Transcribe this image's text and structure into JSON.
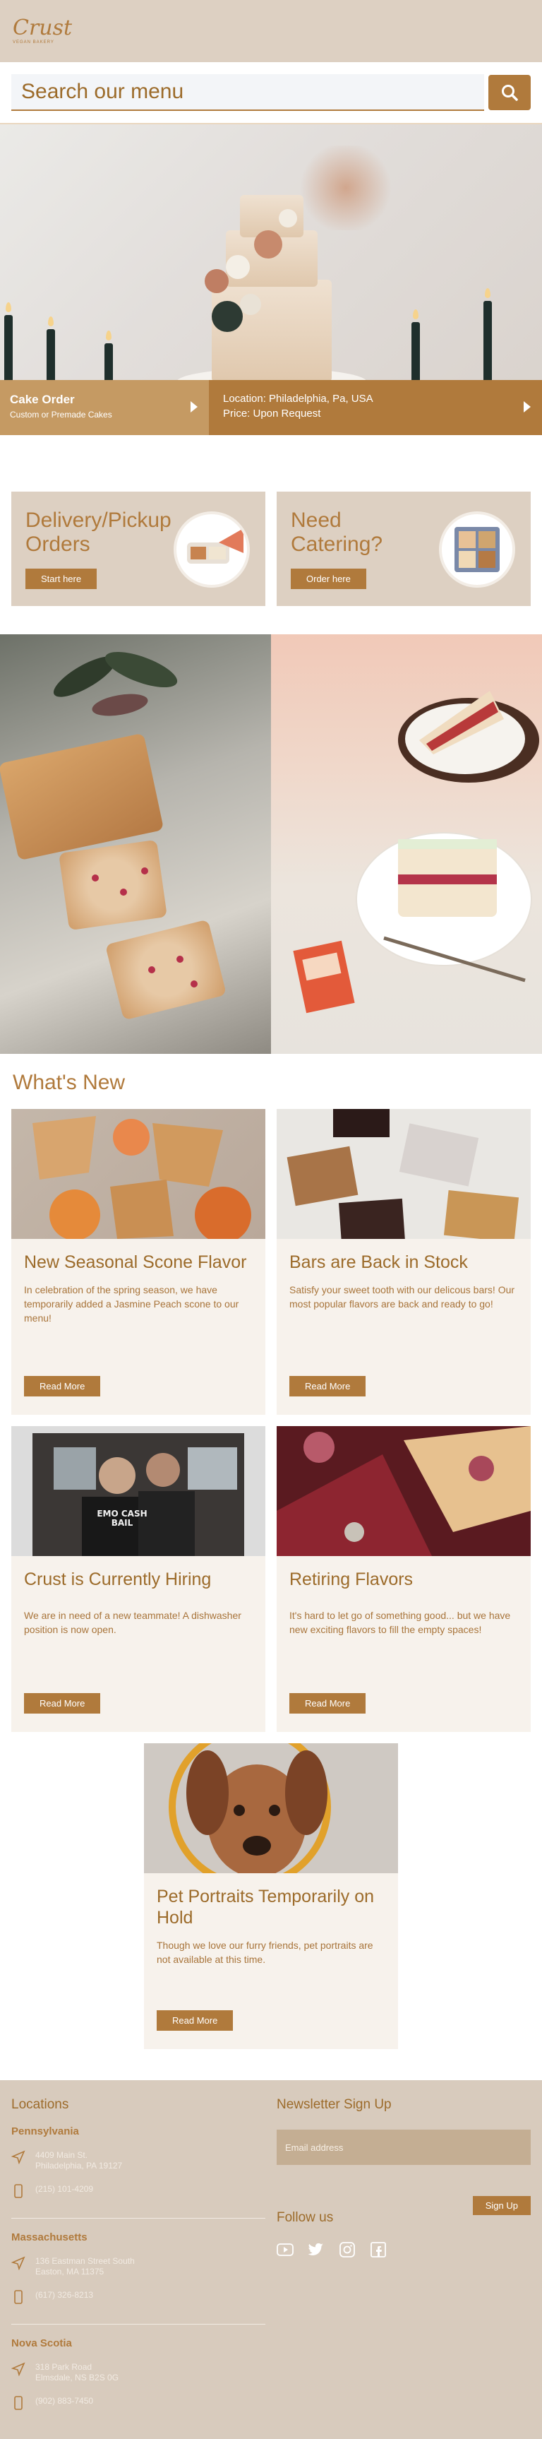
{
  "header": {
    "logo": "Crust",
    "logo_sub": "VEGAN BAKERY",
    "search_placeholder": "Search our menu"
  },
  "hero": {
    "left_title": "Cake Order",
    "left_sub": "Custom or Premade Cakes",
    "right_line1": "Location: Philadelphia, Pa, USA",
    "right_line2": "Price: Upon Request"
  },
  "tiles": [
    {
      "title": "Delivery/Pickup Orders",
      "button": "Start here"
    },
    {
      "title": "Need Catering?",
      "button": "Order here"
    }
  ],
  "whats_new": {
    "title": "What's New",
    "cards": [
      {
        "title": "New Seasonal Scone Flavor",
        "text": "In celebration of the spring season, we have temporarily added a Jasmine Peach scone to our menu!",
        "button": "Read More"
      },
      {
        "title": "Bars are Back in Stock",
        "text": "Satisfy your sweet tooth with our delicous bars! Our most popular flavors are back and ready to go!",
        "button": "Read More"
      },
      {
        "title": "Crust is Currently Hiring",
        "text": "We are in need of a new teammate! A dishwasher position is now open.",
        "button": "Read More"
      },
      {
        "title": "Retiring Flavors",
        "text": "It's hard to let go of something good... but we have new exciting flavors to fill the empty spaces!",
        "button": "Read More"
      },
      {
        "title": "Pet Portraits Temporarily on Hold",
        "text": "Though we love our furry friends, pet portraits are not available at this time.",
        "button": "Read More"
      }
    ],
    "shirt_text": "EMO CASH BAIL"
  },
  "footer": {
    "locations_title": "Locations",
    "locations": [
      {
        "state": "Pennsylvania",
        "address1": "4409 Main St.",
        "address2": "Philadelphia, PA 19127",
        "phone": "(215) 101-4209"
      },
      {
        "state": "Massachusetts",
        "address1": "136 Eastman Street South",
        "address2": "Easton, MA 11375",
        "phone": "(617) 326-8213"
      },
      {
        "state": "Nova Scotia",
        "address1": "318 Park Road",
        "address2": "Elmsdale, NS B2S 0G",
        "phone": "(902) 883-7450"
      }
    ],
    "newsletter_title": "Newsletter Sign Up",
    "email_placeholder": "Email address",
    "signup_button": "Sign Up",
    "follow_title": "Follow us",
    "socials": [
      "youtube-icon",
      "twitter-icon",
      "instagram-icon",
      "facebook-icon"
    ]
  },
  "colors": {
    "accent": "#b07a3c",
    "tan": "#ddd0c2",
    "card_bg": "#f7f2ec",
    "footer_bg": "#d8cbbd"
  }
}
